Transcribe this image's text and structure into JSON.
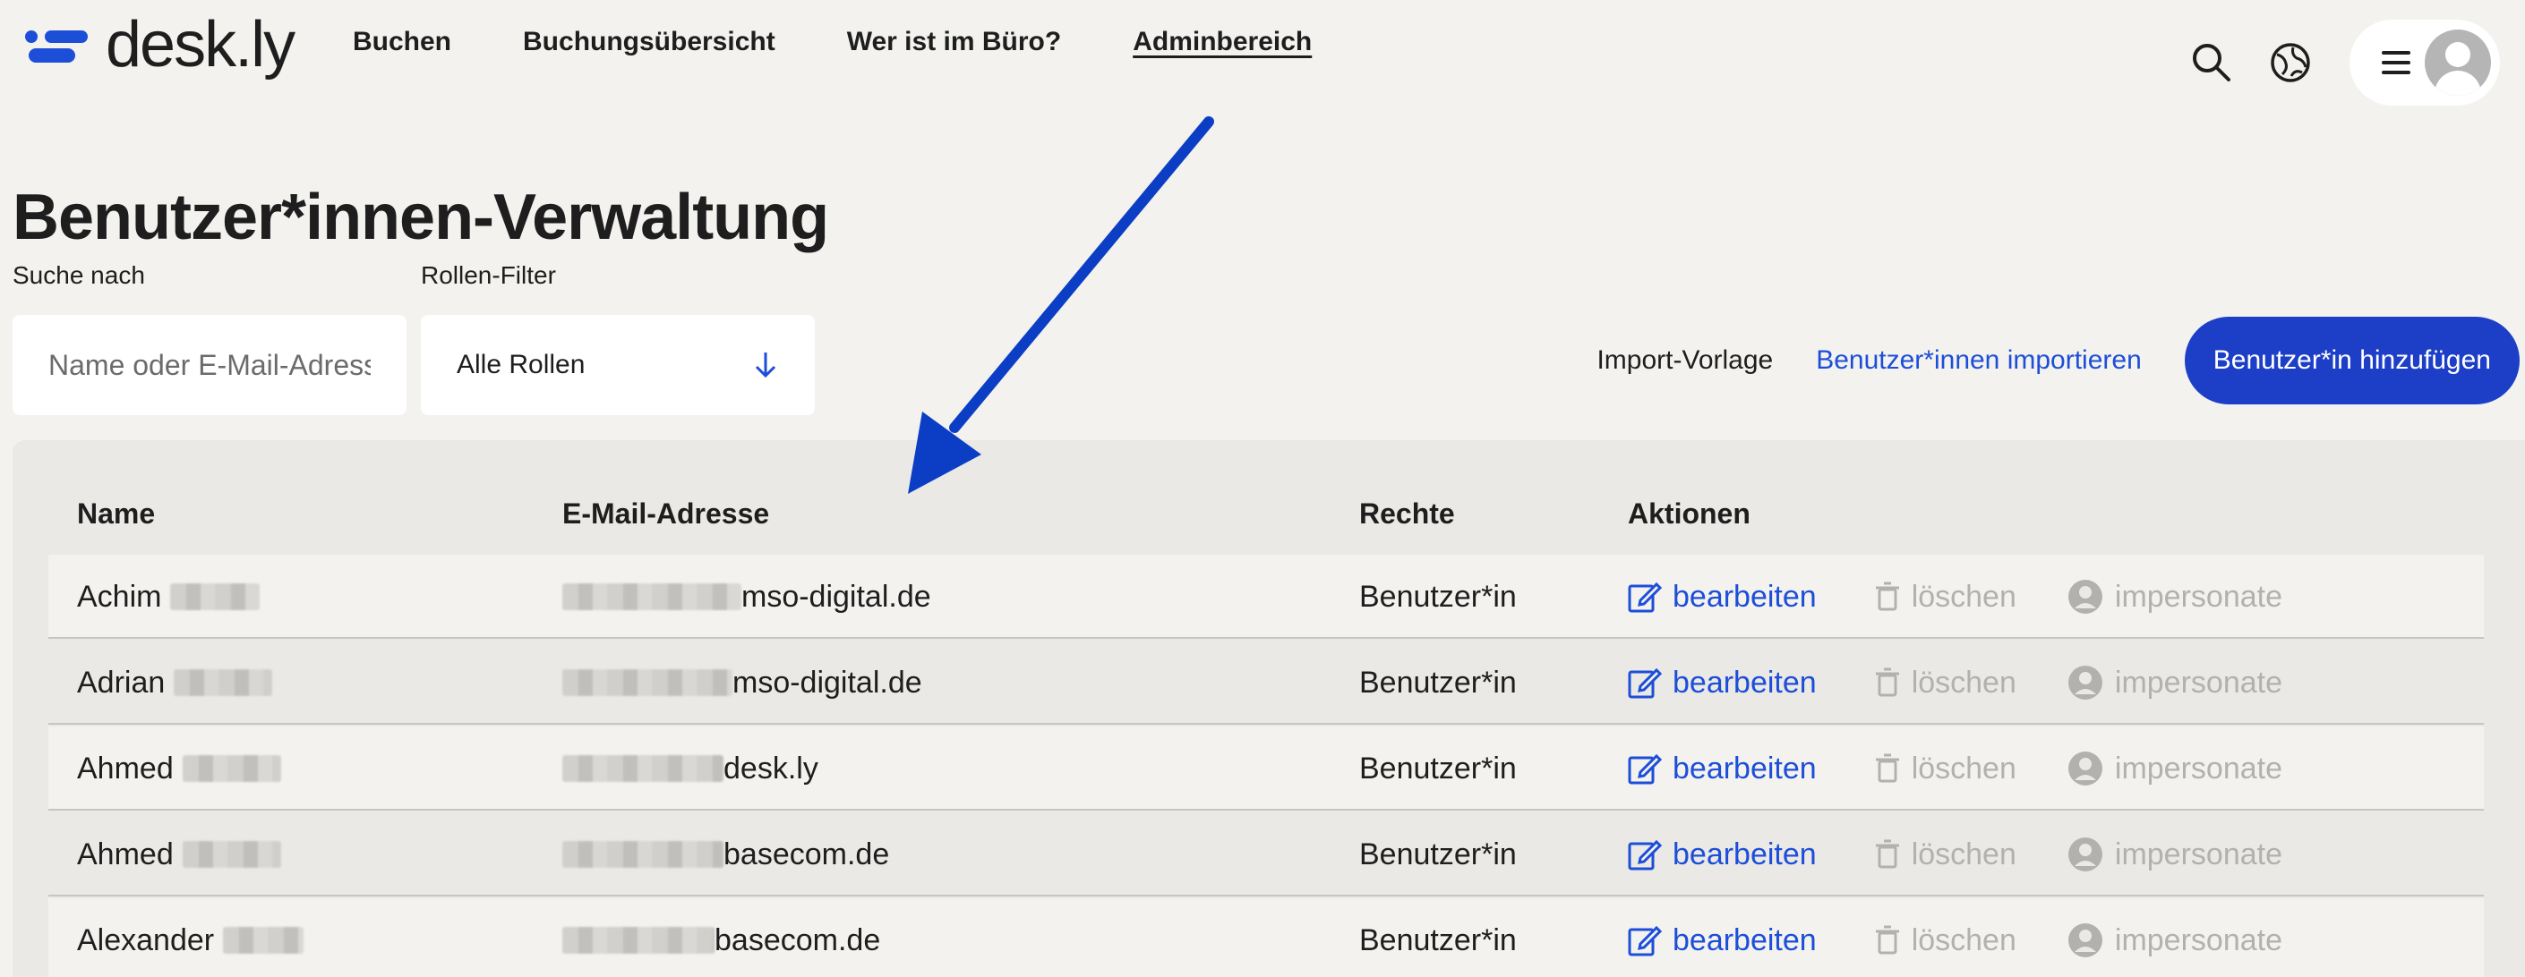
{
  "brand": {
    "name": "desk.ly",
    "color": "#1d4ed8"
  },
  "nav": [
    {
      "label": "Buchen"
    },
    {
      "label": "Buchungsübersicht"
    },
    {
      "label": "Wer ist im Büro?"
    },
    {
      "label": "Adminbereich",
      "active": true
    }
  ],
  "header_icons": [
    "search-icon",
    "globe-icon",
    "hamburger-menu-icon",
    "user-avatar-icon"
  ],
  "page": {
    "title": "Benutzer*innen-Verwaltung"
  },
  "filters": {
    "search_label": "Suche nach",
    "search_placeholder": "Name oder E-Mail-Adresse",
    "search_value": "",
    "role_label": "Rollen-Filter",
    "role_selected": "Alle Rollen"
  },
  "toolbar": {
    "import_template": "Import-Vorlage",
    "import_users": "Benutzer*innen importieren",
    "add_user": "Benutzer*in hinzufügen",
    "primary_color": "#1d3fc7"
  },
  "table": {
    "headers": {
      "name": "Name",
      "email": "E-Mail-Adresse",
      "rights": "Rechte",
      "actions": "Aktionen"
    },
    "action_labels": {
      "edit": "bearbeiten",
      "delete": "löschen",
      "impersonate": "impersonate"
    },
    "rows": [
      {
        "first_name": "Achim",
        "email_domain": "mso-digital.de",
        "rights": "Benutzer*in"
      },
      {
        "first_name": "Adrian",
        "email_domain": "mso-digital.de",
        "rights": "Benutzer*in"
      },
      {
        "first_name": "Ahmed",
        "email_domain": "desk.ly",
        "rights": "Benutzer*in"
      },
      {
        "first_name": "Ahmed",
        "email_domain": "basecom.de",
        "rights": "Benutzer*in"
      },
      {
        "first_name": "Alexander",
        "email_domain": "basecom.de",
        "rights": "Benutzer*in"
      }
    ]
  },
  "annotation": {
    "arrow_color": "#0b3ec4"
  }
}
